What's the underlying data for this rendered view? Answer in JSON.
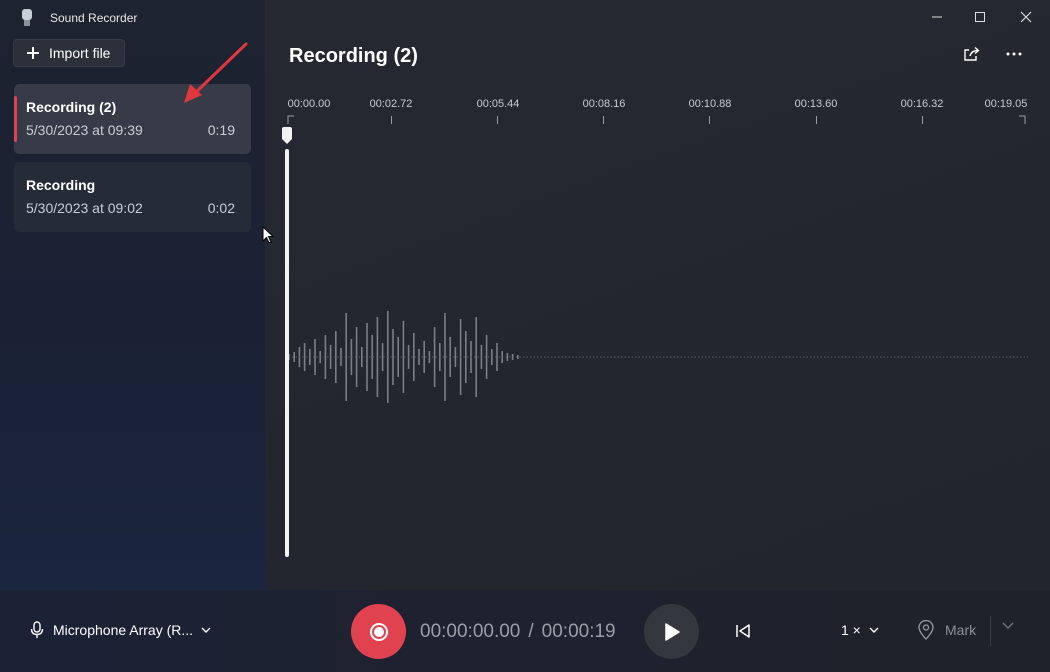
{
  "app": {
    "title": "Sound Recorder",
    "icon": "microphone-app-icon"
  },
  "sidebar": {
    "import_label": "Import file",
    "recordings": [
      {
        "name": "Recording (2)",
        "date": "5/30/2023 at 09:39",
        "duration": "0:19",
        "selected": true
      },
      {
        "name": "Recording",
        "date": "5/30/2023 at 09:02",
        "duration": "0:02",
        "selected": false
      }
    ]
  },
  "main": {
    "title": "Recording (2)",
    "timeline": {
      "labels": [
        "00:00.00",
        "00:02.72",
        "00:05.44",
        "00:08.16",
        "00:10.88",
        "00:13.60",
        "00:16.32",
        "00:19.05"
      ]
    },
    "playhead_position": 0
  },
  "player": {
    "microphone": "Microphone Array (R...",
    "current_time": "00:00:00.00",
    "separator": "/",
    "total_time": "00:00:19",
    "speed": "1 ×",
    "mark_label": "Mark"
  },
  "colors": {
    "accent": "#e0424f",
    "play_button": "#34373e"
  }
}
